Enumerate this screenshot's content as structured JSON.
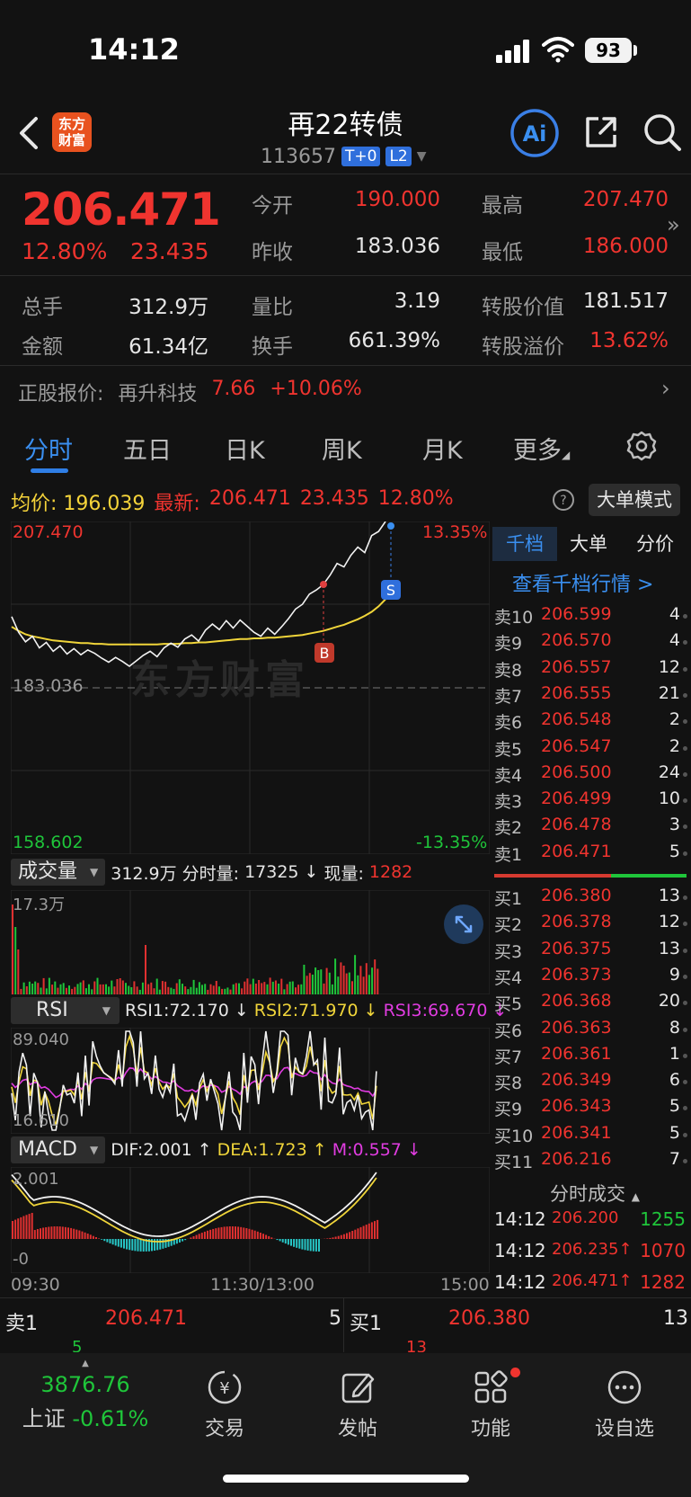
{
  "status_bar": {
    "time": "14:12",
    "battery": "93"
  },
  "header": {
    "logo_line1": "东方",
    "logo_line2": "财富",
    "title": "再22转债",
    "code": "113657",
    "tag_t0": "T+0",
    "tag_l2": "L2",
    "ai_label": "Ai"
  },
  "quote": {
    "price": "206.471",
    "pct": "12.80%",
    "change": "23.435",
    "open_label": "今开",
    "open": "190.000",
    "high_label": "最高",
    "high": "207.470",
    "prev_close_label": "昨收",
    "prev_close": "183.036",
    "low_label": "最低",
    "low": "186.000",
    "volume_label": "总手",
    "volume": "312.9万",
    "vol_ratio_label": "量比",
    "vol_ratio": "3.19",
    "conv_value_label": "转股价值",
    "conv_value": "181.517",
    "amount_label": "金额",
    "amount": "61.34亿",
    "turnover_label": "换手",
    "turnover": "661.39%",
    "premium_label": "转股溢价",
    "premium": "13.62%"
  },
  "underlying": {
    "label": "正股报价:",
    "name": "再升科技",
    "price": "7.66",
    "pct": "+10.06%"
  },
  "tabs": {
    "t1": "分时",
    "t2": "五日",
    "t3": "日K",
    "t4": "周K",
    "t5": "月K",
    "t6": "更多"
  },
  "avg_row": {
    "avg_label": "均价:",
    "avg": "196.039",
    "latest_label": "最新:",
    "latest": "206.471",
    "change": "23.435",
    "pct": "12.80%",
    "big_order": "大单模式"
  },
  "chart_data": {
    "type": "line",
    "price_axis": {
      "max": "207.470",
      "mid": "183.036",
      "min": "158.602",
      "max_pct": "13.35%",
      "min_pct": "-13.35%"
    },
    "time_axis": {
      "start": "09:30",
      "mid": "11:30/13:00",
      "end": "15:00"
    },
    "ylim": [
      158.602,
      207.47
    ],
    "price": [
      193.5,
      191.2,
      189.8,
      190.6,
      188.9,
      189.7,
      188.4,
      189.2,
      188.0,
      188.8,
      187.9,
      188.6,
      188.1,
      187.4,
      186.8,
      187.5,
      186.9,
      186.2,
      187.0,
      187.8,
      188.4,
      187.6,
      188.9,
      189.6,
      189.0,
      190.2,
      190.8,
      189.9,
      191.5,
      192.4,
      191.6,
      192.9,
      191.8,
      193.0,
      192.1,
      191.2,
      190.6,
      191.8,
      190.9,
      192.0,
      193.2,
      194.6,
      195.3,
      196.8,
      197.4,
      198.2,
      199.6,
      201.3,
      200.8,
      202.5,
      203.7,
      202.9,
      205.4,
      206.0,
      207.47
    ],
    "avg": [
      192.0,
      191.4,
      190.9,
      190.6,
      190.4,
      190.2,
      190.0,
      189.9,
      189.8,
      189.7,
      189.6,
      189.6,
      189.5,
      189.5,
      189.4,
      189.4,
      189.4,
      189.4,
      189.4,
      189.4,
      189.4,
      189.4,
      189.5,
      189.5,
      189.5,
      189.6,
      189.6,
      189.7,
      189.7,
      189.8,
      189.9,
      190.0,
      190.1,
      190.2,
      190.2,
      190.3,
      190.3,
      190.4,
      190.4,
      190.5,
      190.6,
      190.7,
      190.8,
      191.0,
      191.2,
      191.4,
      191.7,
      192.0,
      192.3,
      192.7,
      193.1,
      193.6,
      194.2,
      195.0,
      196.039
    ],
    "markers": [
      {
        "label": "B",
        "type": "buy"
      },
      {
        "label": "S",
        "type": "sell"
      }
    ],
    "volume": {
      "label": "成交量",
      "total": "312.9万",
      "period_label": "分时量:",
      "period": "17325",
      "current_label": "现量:",
      "current": "1282",
      "max": "17.3万"
    },
    "rsi": {
      "label": "RSI",
      "rsi1": "RSI1:72.170",
      "rsi2": "RSI2:71.970",
      "rsi3": "RSI3:69.670",
      "top": "89.040",
      "bottom": "16.610"
    },
    "macd": {
      "label": "MACD",
      "dif": "DIF:2.001",
      "dea": "DEA:1.723",
      "m": "M:0.557",
      "top": "2.001",
      "bottom": "-0"
    }
  },
  "order_book": {
    "tab1": "千档",
    "tab2": "大单",
    "tab3": "分价",
    "link": "查看千档行情 >",
    "asks": [
      {
        "label": "卖10",
        "price": "206.599",
        "vol": "4"
      },
      {
        "label": "卖9",
        "price": "206.570",
        "vol": "4"
      },
      {
        "label": "卖8",
        "price": "206.557",
        "vol": "12"
      },
      {
        "label": "卖7",
        "price": "206.555",
        "vol": "21"
      },
      {
        "label": "卖6",
        "price": "206.548",
        "vol": "2"
      },
      {
        "label": "卖5",
        "price": "206.547",
        "vol": "2"
      },
      {
        "label": "卖4",
        "price": "206.500",
        "vol": "24"
      },
      {
        "label": "卖3",
        "price": "206.499",
        "vol": "10"
      },
      {
        "label": "卖2",
        "price": "206.478",
        "vol": "3"
      },
      {
        "label": "卖1",
        "price": "206.471",
        "vol": "5"
      }
    ],
    "bids": [
      {
        "label": "买1",
        "price": "206.380",
        "vol": "13"
      },
      {
        "label": "买2",
        "price": "206.378",
        "vol": "12"
      },
      {
        "label": "买3",
        "price": "206.375",
        "vol": "13"
      },
      {
        "label": "买4",
        "price": "206.373",
        "vol": "9"
      },
      {
        "label": "买5",
        "price": "206.368",
        "vol": "20"
      },
      {
        "label": "买6",
        "price": "206.363",
        "vol": "8"
      },
      {
        "label": "买7",
        "price": "206.361",
        "vol": "1"
      },
      {
        "label": "买8",
        "price": "206.349",
        "vol": "6"
      },
      {
        "label": "买9",
        "price": "206.343",
        "vol": "5"
      },
      {
        "label": "买10",
        "price": "206.341",
        "vol": "5"
      },
      {
        "label": "买11",
        "price": "206.216",
        "vol": "7"
      }
    ],
    "trades_title": "分时成交",
    "trades": [
      {
        "time": "14:12",
        "price": "206.200",
        "vol": "1255"
      },
      {
        "time": "14:12",
        "price": "206.235↑",
        "vol": "1070"
      },
      {
        "time": "14:12",
        "price": "206.471↑",
        "vol": "1282"
      }
    ]
  },
  "bidask": {
    "ask_label": "卖1",
    "ask_price": "206.471",
    "ask_vol": "5",
    "bid_label": "买1",
    "bid_price": "206.380",
    "bid_vol": "13",
    "below_left": "5",
    "below_right": "13"
  },
  "watermark": "东方财富",
  "nav": {
    "index_value": "3876.76",
    "index_name": "上证",
    "index_pct": "-0.61%",
    "trade": "交易",
    "post": "发帖",
    "func": "功能",
    "watch": "设自选"
  }
}
